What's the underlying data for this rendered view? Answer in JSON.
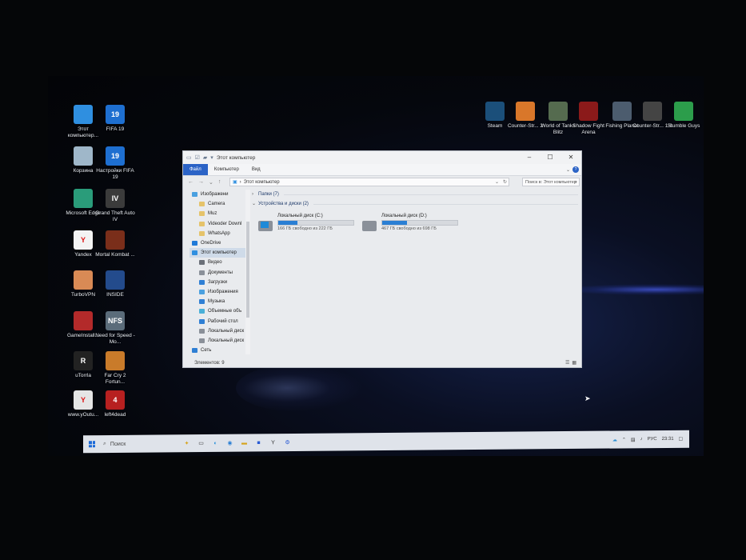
{
  "desktop_left": [
    {
      "label": "Этот компьютер...",
      "icon": "this-pc-icon",
      "color": "#2f8fe0"
    },
    {
      "label": "FIFA 19",
      "icon": "fifa19-icon",
      "color": "#1e6fd0",
      "glyph": "19"
    },
    {
      "label": "Корзина",
      "icon": "recycle-bin-icon",
      "color": "#9fb7c9"
    },
    {
      "label": "Настройки FIFA 19",
      "icon": "fifa19-settings-icon",
      "color": "#1e6fd0",
      "glyph": "19"
    },
    {
      "label": "Microsoft Edge",
      "icon": "edge-icon",
      "color": "#2a9c7a"
    },
    {
      "label": "Grand Theft Auto IV",
      "icon": "gta4-icon",
      "color": "#3b3b3b",
      "glyph": "IV"
    },
    {
      "label": "Yandex",
      "icon": "yandex-icon",
      "color": "#f3f3f3",
      "glyph": "Y"
    },
    {
      "label": "Mortal Kombat ...",
      "icon": "mortal-kombat-icon",
      "color": "#7a2e1a"
    },
    {
      "label": "TurboVPN",
      "icon": "turbovpn-icon",
      "color": "#d98a55"
    },
    {
      "label": "INSIDE",
      "icon": "inside-icon",
      "color": "#234b8c"
    },
    {
      "label": "GameInstall...",
      "icon": "game-installer-icon",
      "color": "#b32a2a"
    },
    {
      "label": "Need for Speed - Mo...",
      "icon": "nfs-icon",
      "color": "#5b6c7a",
      "glyph": "NFS"
    },
    {
      "label": "uTorrla",
      "icon": "utorrla-icon",
      "color": "#222",
      "glyph": "R"
    },
    {
      "label": "Far Cry 2 Fortun...",
      "icon": "farcry2-icon",
      "color": "#c97b2a"
    },
    {
      "label": "www.yOutu...",
      "icon": "youtube-shortcut-icon",
      "color": "#e5e5e5",
      "glyph": "Y"
    },
    {
      "label": "left4dead",
      "icon": "left4dead-icon",
      "color": "#b72020",
      "glyph": "4"
    }
  ],
  "desktop_right": [
    {
      "label": "Steam",
      "icon": "steam-icon",
      "color": "#1b4f7a"
    },
    {
      "label": "Counter-Str... 2",
      "icon": "cs2-icon",
      "color": "#d9772a"
    },
    {
      "label": "World of Tanks Blitz",
      "icon": "wot-blitz-icon",
      "color": "#556b4f"
    },
    {
      "label": "Shadow Fight Arena",
      "icon": "shadow-fight-icon",
      "color": "#8b1a1a"
    },
    {
      "label": "Fishing Planet",
      "icon": "fishing-planet-icon",
      "color": "#4c5c6e"
    },
    {
      "label": "Counter-Str... 1.6",
      "icon": "cs16-icon",
      "color": "#444"
    },
    {
      "label": "Stumble Guys",
      "icon": "stumble-guys-icon",
      "color": "#2c9d4b"
    }
  ],
  "window": {
    "title": "Этот компьютер",
    "tabs": [
      "Файл",
      "Компьютер",
      "Вид"
    ],
    "address": "Этот компьютер",
    "search_placeholder": "Поиск в: Этот компьютер",
    "nav_items": [
      {
        "label": "Изображени",
        "icon": "pictures-icon",
        "color": "#4aa0e0"
      },
      {
        "label": "Camera",
        "icon": "folder-icon",
        "color": "#e5c36a"
      },
      {
        "label": "Muz",
        "icon": "folder-icon",
        "color": "#e5c36a"
      },
      {
        "label": "Videoder Downl",
        "icon": "folder-icon",
        "color": "#e5c36a"
      },
      {
        "label": "WhatsApp",
        "icon": "folder-icon",
        "color": "#e5c36a"
      },
      {
        "label": "OneDrive",
        "icon": "onedrive-icon",
        "color": "#1f7ad8"
      },
      {
        "label": "Этот компьютер",
        "icon": "this-pc-icon",
        "color": "#2f8fe0",
        "selected": true
      },
      {
        "label": "Видео",
        "icon": "video-icon",
        "color": "#6a6f78"
      },
      {
        "label": "Документы",
        "icon": "documents-icon",
        "color": "#8a9099"
      },
      {
        "label": "Загрузки",
        "icon": "downloads-icon",
        "color": "#2f7fd4"
      },
      {
        "label": "Изображения",
        "icon": "pictures-icon",
        "color": "#4aa0e0"
      },
      {
        "label": "Музыка",
        "icon": "music-icon",
        "color": "#2f7fd4"
      },
      {
        "label": "Объемные объ",
        "icon": "3d-objects-icon",
        "color": "#4ab0d8"
      },
      {
        "label": "Рабочий стол",
        "icon": "desktop-icon",
        "color": "#2f7fd4"
      },
      {
        "label": "Локальный диск",
        "icon": "drive-icon",
        "color": "#8a9099"
      },
      {
        "label": "Локальный диск",
        "icon": "drive-icon",
        "color": "#8a9099"
      },
      {
        "label": "Сеть",
        "icon": "network-icon",
        "color": "#2f7fd4"
      }
    ],
    "groups": {
      "folders": "Папки (7)",
      "drives": "Устройства и диски (2)"
    },
    "drives": [
      {
        "name": "Локальный диск (C:)",
        "free_text": "166 ГБ свободно из 222 ГБ",
        "used_fraction": 0.25
      },
      {
        "name": "Локальный диск (D:)",
        "free_text": "467 ГБ свободно из 698 ГБ",
        "used_fraction": 0.33
      }
    ],
    "status": "Элементов: 9"
  },
  "taskbar": {
    "search": "Поиск",
    "tray_lang": "РУС",
    "tray_time": "23:31"
  }
}
